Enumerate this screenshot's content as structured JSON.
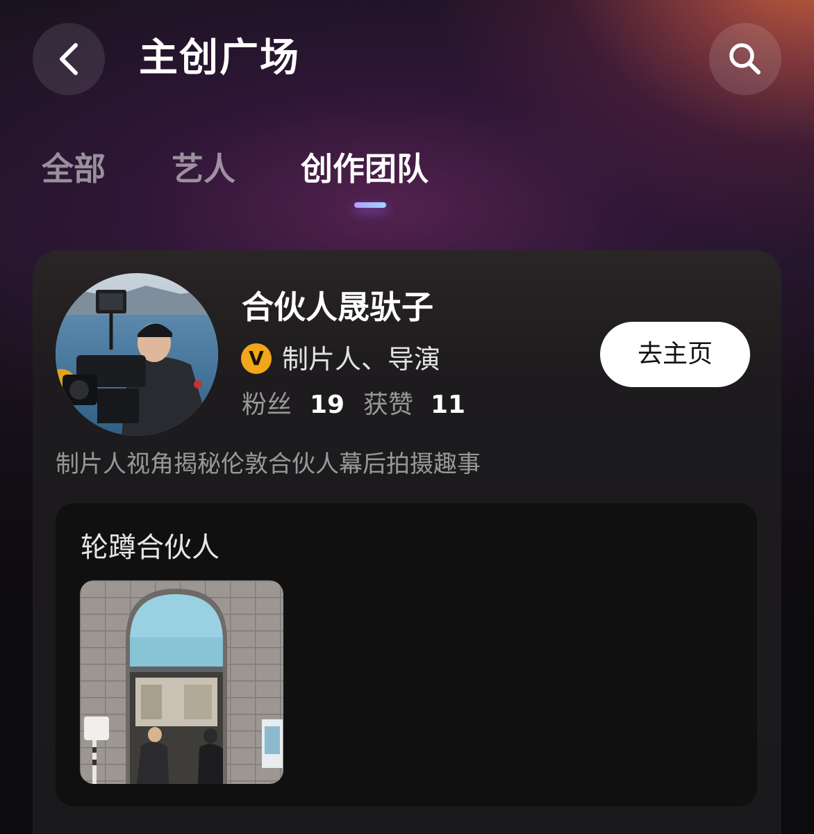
{
  "header": {
    "title": "主创广场"
  },
  "tabs": [
    {
      "label": "全部",
      "active": false
    },
    {
      "label": "艺人",
      "active": false
    },
    {
      "label": "创作团队",
      "active": true
    }
  ],
  "creator": {
    "name": "合伙人晟驮子",
    "badge_letter": "V",
    "role": "制片人、导演",
    "fans_label": "粉丝",
    "fans_count": "19",
    "likes_label": "获赞",
    "likes_count": "11",
    "homepage_button": "去主页",
    "description": "制片人视角揭秘伦敦合伙人幕后拍摄趣事"
  },
  "collection": {
    "title": "轮蹲合伙人"
  },
  "icons": {
    "back": "chevron-left-icon",
    "search": "search-icon",
    "verified": "verified-v-icon"
  },
  "colors": {
    "badge": "#f2a619",
    "tab_indicator_start": "#b79cff",
    "tab_indicator_end": "#9fd6ff",
    "home_button_bg": "#ffffff"
  }
}
